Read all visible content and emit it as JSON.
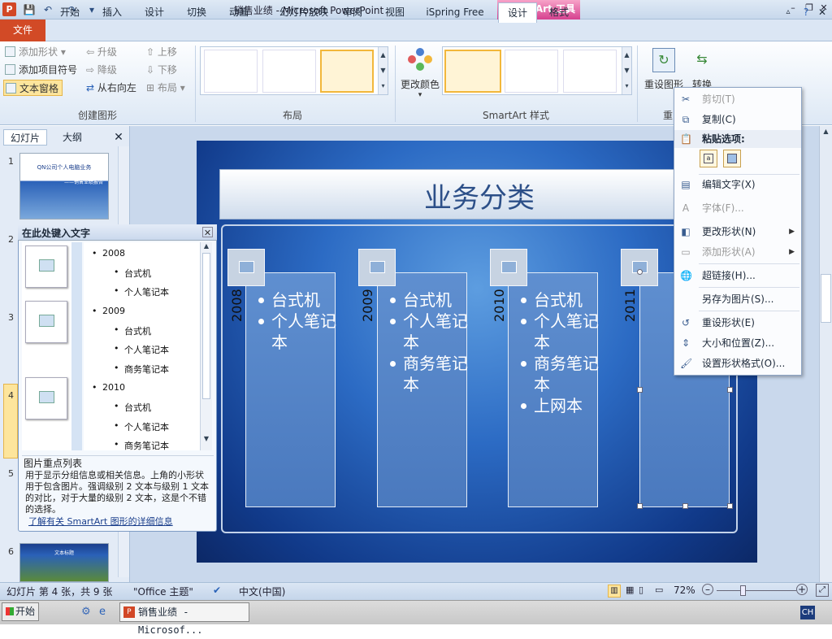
{
  "window": {
    "title": "销售业绩 - Microsoft PowerPoint",
    "context_tab": "SmartArt 工具",
    "app_icon": "P"
  },
  "tabs": [
    "文件",
    "开始",
    "插入",
    "设计",
    "切换",
    "动画",
    "幻灯片放映",
    "审阅",
    "视图",
    "iSpring Free",
    "设计",
    "格式"
  ],
  "ribbon": {
    "create_graphic": {
      "add_shape": "添加形状",
      "add_bullet": "添加项目符号",
      "text_pane": "文本窗格",
      "promote": "升级",
      "demote": "降级",
      "right_to_left": "从右向左",
      "move_up": "上移",
      "move_down": "下移",
      "layout": "布局",
      "group_label": "创建图形"
    },
    "layouts_label": "布局",
    "change_colors": "更改颜色",
    "styles_label": "SmartArt 样式",
    "reset_graphic": "重设图形",
    "convert": "转换",
    "reset_group_partial": "重"
  },
  "slide_panel": {
    "tabs": [
      "幻灯片",
      "大纲"
    ],
    "slide_numbers": [
      "1",
      "2",
      "3",
      "4",
      "5",
      "6"
    ],
    "slide1_title": "QN公司个人电脑业务",
    "slide1_subtitle": "——销售业绩报告",
    "slide6_title": "文本标题"
  },
  "text_pane": {
    "title": "在此处键入文字",
    "rows": [
      {
        "level": 1,
        "text": "2008"
      },
      {
        "level": 2,
        "text": "台式机"
      },
      {
        "level": 2,
        "text": "个人笔记本"
      },
      {
        "level": 1,
        "text": "2009"
      },
      {
        "level": 2,
        "text": "台式机"
      },
      {
        "level": 2,
        "text": "个人笔记本"
      },
      {
        "level": 2,
        "text": "商务笔记本"
      },
      {
        "level": 1,
        "text": "2010"
      },
      {
        "level": 2,
        "text": "台式机"
      },
      {
        "level": 2,
        "text": "个人笔记本"
      },
      {
        "level": 2,
        "text": "商务笔记本"
      }
    ],
    "desc_title": "图片重点列表",
    "desc_body": "用于显示分组信息或相关信息。上角的小形状用于包含图片。强调级别 2 文本与级别 1 文本的对比，对于大量的级别 2 文本，这是个不错的选择。",
    "desc_link": "了解有关 SmartArt 图形的详细信息"
  },
  "slide": {
    "title": "业务分类",
    "columns": [
      {
        "year": "2008",
        "items": [
          "台式机",
          "个人笔记本"
        ]
      },
      {
        "year": "2009",
        "items": [
          "台式机",
          "个人笔记本",
          "商务笔记本"
        ]
      },
      {
        "year": "2010",
        "items": [
          "台式机",
          "个人笔记本",
          "商务笔记本",
          "上网本"
        ]
      },
      {
        "year": "2011",
        "items": []
      }
    ]
  },
  "context_menu": {
    "cut": "剪切(T)",
    "copy": "复制(C)",
    "paste_options": "粘贴选项:",
    "edit_text": "编辑文字(X)",
    "font": "字体(F)...",
    "change_shape": "更改形状(N)",
    "add_shape": "添加形状(A)",
    "hyperlink": "超链接(H)...",
    "save_as_picture": "另存为图片(S)...",
    "reset_shape": "重设形状(E)",
    "size_position": "大小和位置(Z)...",
    "format_shape": "设置形状格式(O)..."
  },
  "status": {
    "slide_info": "幻灯片 第 4 张，共 9 张",
    "theme": "\"Office 主题\"",
    "language": "中文(中国)",
    "zoom": "72%"
  },
  "taskbar": {
    "start": "开始",
    "ppt_task": "销售业绩 - Microsof...",
    "lang": "CH"
  },
  "colors": {
    "file_tab": "#d24a26",
    "context_tab": "#d6418f",
    "selection": "#f2b73b"
  }
}
